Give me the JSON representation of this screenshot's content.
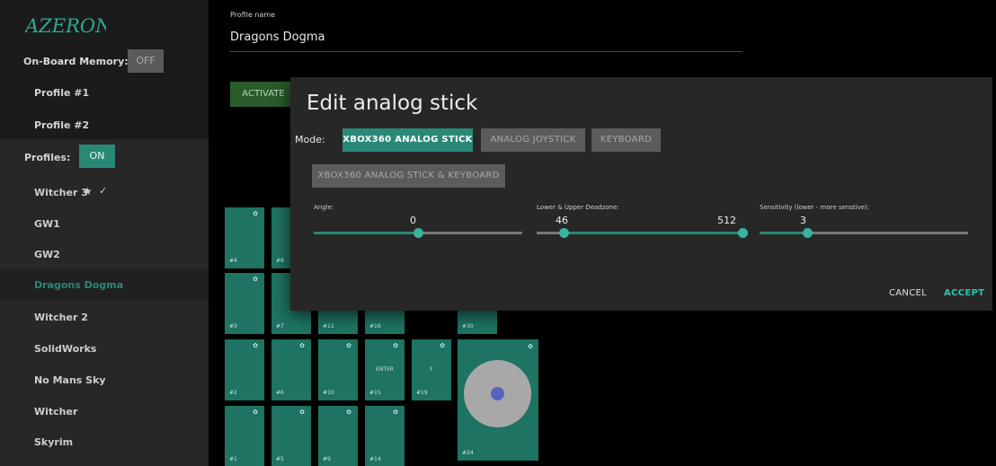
{
  "sidebar": {
    "logo_text": "AZERON",
    "memory_label": "On-Board Memory:",
    "memory_toggle": "OFF",
    "memory_profiles": [
      "Profile #1",
      "Profile #2"
    ],
    "profiles_label": "Profiles:",
    "profiles_toggle": "ON",
    "profiles": [
      {
        "label": "Witcher 3",
        "active": true,
        "favorite": true,
        "selected": false
      },
      {
        "label": "GW1",
        "selected": false
      },
      {
        "label": "GW2",
        "selected": false
      },
      {
        "label": "Dragons Dogma",
        "selected": true
      },
      {
        "label": "Witcher 2",
        "selected": false
      },
      {
        "label": "SolidWorks",
        "selected": false
      },
      {
        "label": "No Mans Sky",
        "selected": false
      },
      {
        "label": "Witcher",
        "selected": false
      },
      {
        "label": "Skyrim",
        "selected": false
      }
    ],
    "favorite_icon": "star-icon",
    "active_icon": "checkmark-icon"
  },
  "main": {
    "profile_name_label": "Profile name",
    "profile_name_value": "Dragons Dogma",
    "activate_label": "ACTIVATE",
    "keys": [
      {
        "num": "#4"
      },
      {
        "num": "#8"
      },
      {
        "num": "#3"
      },
      {
        "num": "#7"
      },
      {
        "num": "#11"
      },
      {
        "num": "#16"
      },
      {
        "num": "#30"
      },
      {
        "num": "#2"
      },
      {
        "num": "#6"
      },
      {
        "num": "#10"
      },
      {
        "num": "#15",
        "label": "ENTER"
      },
      {
        "num": "#19",
        "label": "F"
      },
      {
        "num": "#1"
      },
      {
        "num": "#5"
      },
      {
        "num": "#9"
      },
      {
        "num": "#14"
      }
    ],
    "stick_key_num": "#24"
  },
  "modal": {
    "title": "Edit analog stick",
    "mode_label": "Mode:",
    "modes": [
      {
        "label": "XBOX360 ANALOG STICK",
        "active": true
      },
      {
        "label": "ANALOG JOYSTICK",
        "active": false
      },
      {
        "label": "KEYBOARD",
        "active": false
      },
      {
        "label": "XBOX360 ANALOG STICK & KEYBOARD",
        "active": false
      }
    ],
    "sliders": {
      "angle": {
        "label": "Angle:",
        "value": "0",
        "position": 0.5
      },
      "deadzone": {
        "label": "Lower & Upper Deadzone:",
        "lower": "46",
        "upper": "512",
        "lower_position": 0.13,
        "upper_position": 0.99
      },
      "sensitivity": {
        "label": "Sensitivity (lower - more senstive):",
        "value": "3",
        "position": 0.23
      }
    },
    "cancel_label": "CANCEL",
    "accept_label": "ACCEPT"
  },
  "colors": {
    "accent": "#2a8876",
    "key_fill": "#1e7362",
    "sidebar_bg": "#1b1b1b",
    "modal_bg": "#272727",
    "activate": "#2a5c2c",
    "stick_dot": "#5a62c0"
  }
}
